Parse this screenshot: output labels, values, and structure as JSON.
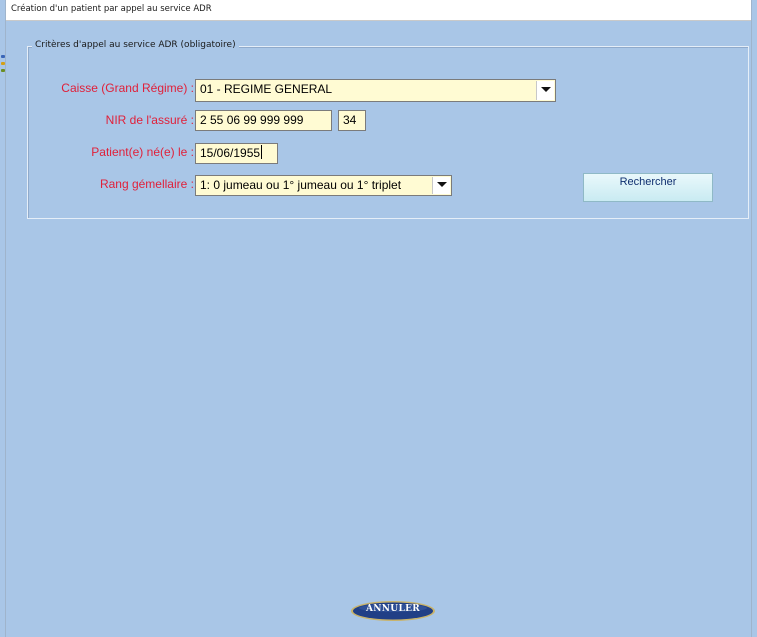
{
  "window": {
    "title": "Création d'un patient par appel au service ADR"
  },
  "group": {
    "legend": "Critères d'appel au service ADR (obligatoire)"
  },
  "form": {
    "caisse": {
      "label": "Caisse (Grand Régime) :",
      "value": "01 - REGIME GENERAL"
    },
    "nir": {
      "label": "NIR de l'assuré :",
      "value": "2 55 06 99 999 999",
      "key": "34"
    },
    "naissance": {
      "label": "Patient(e) né(e) le :",
      "value": "15/06/1955"
    },
    "rang": {
      "label": "Rang gémellaire :",
      "value": "1: 0 jumeau ou 1° jumeau ou 1° triplet"
    }
  },
  "buttons": {
    "rechercher": "Rechercher",
    "annuler": "ANNULER"
  },
  "colors": {
    "background": "#a9c6e7",
    "label": "#e0203a",
    "field": "#fffbd3",
    "annuler_button": "#213f86"
  }
}
